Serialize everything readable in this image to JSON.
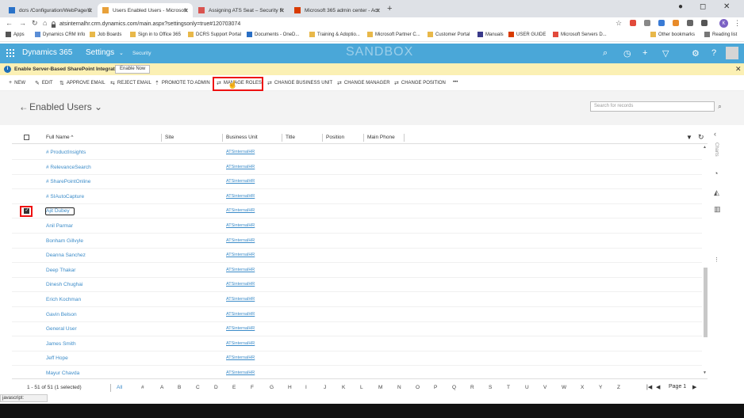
{
  "browser": {
    "tabs": [
      {
        "label": "dcrs /Configuration/WebPage/C",
        "active": false,
        "favicon": "#2a72c8"
      },
      {
        "label": "Users Enabled Users - Microsoft",
        "active": true,
        "favicon": "#e8a13a"
      },
      {
        "label": "Assigning ATS Seat – Security R",
        "active": false,
        "favicon": "#d9534f"
      },
      {
        "label": "Microsoft 365 admin center - Act",
        "active": false,
        "favicon": "#d83b01"
      }
    ],
    "url": "atsinternalhr.crm.dynamics.com/main.aspx?settingsonly=true#120703074",
    "profile_initial": "K"
  },
  "bookmarks": [
    {
      "label": "Apps"
    },
    {
      "label": "Dynamics CRM Info"
    },
    {
      "label": "Job Boards"
    },
    {
      "label": "Sign in to Office 365"
    },
    {
      "label": "DCRS Support Portal"
    },
    {
      "label": "Documents - OneD..."
    },
    {
      "label": "Training & Adoptio..."
    },
    {
      "label": "Microsoft Partner C..."
    },
    {
      "label": "Customer Portal"
    },
    {
      "label": "Manuals"
    },
    {
      "label": "USER GUIDE"
    },
    {
      "label": "Microsoft Servers D..."
    },
    {
      "label": "Other bookmarks"
    },
    {
      "label": "Reading list"
    }
  ],
  "header": {
    "app": "Dynamics 365",
    "area": "Settings",
    "subarea": "Security",
    "watermark": "SANDBOX"
  },
  "notification": {
    "message": "Enable Server-Based SharePoint Integration",
    "button": "Enable Now"
  },
  "commands": [
    {
      "label": "NEW",
      "icon": "+"
    },
    {
      "label": "EDIT",
      "icon": "✎"
    },
    {
      "label": "APPROVE EMAIL",
      "icon": "⇅"
    },
    {
      "label": "REJECT EMAIL",
      "icon": "⇆"
    },
    {
      "label": "PROMOTE TO ADMIN",
      "icon": "⇡"
    },
    {
      "label": "MANAGE ROLES",
      "icon": "⇄"
    },
    {
      "label": "CHANGE BUSINESS UNIT",
      "icon": "⇄"
    },
    {
      "label": "CHANGE MANAGER",
      "icon": "⇄"
    },
    {
      "label": "CHANGE POSITION",
      "icon": "⇄"
    }
  ],
  "view": {
    "title": "Enabled Users",
    "search_placeholder": "Search for records"
  },
  "columns": [
    "Full Name ^",
    "Site",
    "Business Unit",
    "Title",
    "Position",
    "Main Phone"
  ],
  "rows": [
    {
      "name": "# ProductInsights",
      "bu": "ATSinternalHR",
      "selected": false
    },
    {
      "name": "# RelevanceSearch",
      "bu": "ATSinternalHR",
      "selected": false
    },
    {
      "name": "# SharePointOnline",
      "bu": "ATSinternalHR",
      "selected": false
    },
    {
      "name": "# SIAutoCapture",
      "bu": "ATSinternalHR",
      "selected": false
    },
    {
      "name": "Ajit Dubey",
      "bu": "ATSinternalHR",
      "selected": true
    },
    {
      "name": "Anil Parmar",
      "bu": "ATSinternalHR",
      "selected": false
    },
    {
      "name": "Bonham Gillvyle",
      "bu": "ATSinternalHR",
      "selected": false
    },
    {
      "name": "Deanna Sanchez",
      "bu": "ATSinternalHR",
      "selected": false
    },
    {
      "name": "Deep Thakar",
      "bu": "ATSinternalHR",
      "selected": false
    },
    {
      "name": "Dinesh Chughai",
      "bu": "ATSinternalHR",
      "selected": false
    },
    {
      "name": "Erich Kochman",
      "bu": "ATSinternalHR",
      "selected": false
    },
    {
      "name": "Gavin Belson",
      "bu": "ATSinternalHR",
      "selected": false
    },
    {
      "name": "General User",
      "bu": "ATSinternalHR",
      "selected": false
    },
    {
      "name": "James Smith",
      "bu": "ATSinternalHR",
      "selected": false
    },
    {
      "name": "Jeff Hope",
      "bu": "ATSinternalHR",
      "selected": false
    },
    {
      "name": "Mayur Chavda",
      "bu": "ATSinternalHR",
      "selected": false
    }
  ],
  "footer": {
    "count": "1 - 51 of 51 (1 selected)",
    "letters": [
      "All",
      "#",
      "A",
      "B",
      "C",
      "D",
      "E",
      "F",
      "G",
      "H",
      "I",
      "J",
      "K",
      "L",
      "M",
      "N",
      "O",
      "P",
      "Q",
      "R",
      "S",
      "T",
      "U",
      "V",
      "W",
      "X",
      "Y",
      "Z"
    ],
    "page": "Page 1"
  },
  "side_panel": {
    "label": "Charts"
  },
  "status": "javascript:"
}
